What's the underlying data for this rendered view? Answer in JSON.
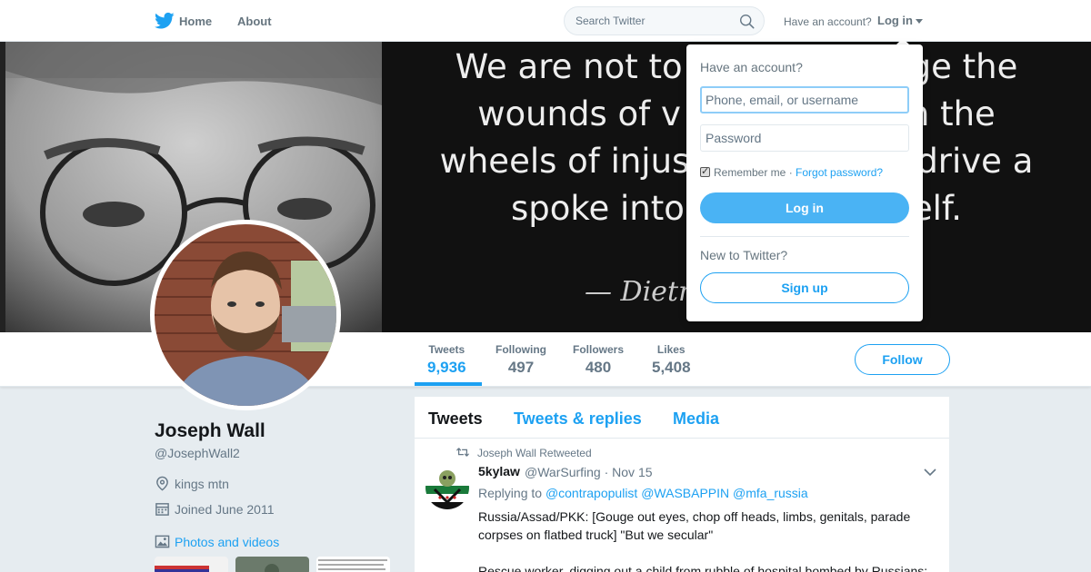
{
  "nav": {
    "home_label": "Home",
    "about_label": "About",
    "search_placeholder": "Search Twitter",
    "have_account": "Have an account?",
    "login_label": "Log in"
  },
  "header": {
    "quote_lines": [
      "We are not to",
      "ge the",
      "wounds of v",
      "n the",
      "wheels of injus",
      "drive a",
      "spoke into",
      "elf."
    ],
    "signature": "— Dietr"
  },
  "stats": {
    "tweets": {
      "label": "Tweets",
      "value": "9,936"
    },
    "following": {
      "label": "Following",
      "value": "497"
    },
    "followers": {
      "label": "Followers",
      "value": "480"
    },
    "likes": {
      "label": "Likes",
      "value": "5,408"
    },
    "follow_label": "Follow"
  },
  "profile": {
    "name": "Joseph Wall",
    "handle": "@JosephWall2",
    "location": "kings mtn",
    "joined": "Joined June 2011",
    "photos_label": "Photos and videos"
  },
  "timeline": {
    "tabs": [
      "Tweets",
      "Tweets & replies",
      "Media"
    ],
    "tweet": {
      "retweet_context": "Joseph Wall Retweeted",
      "name": "5kylaw",
      "handle_date": "@WarSurfing · Nov 15",
      "replying_prefix": "Replying to",
      "mentions": "@contrapopulist @WASBAPPIN @mfa_russia",
      "body": "Russia/Assad/PKK: [Gouge out eyes, chop off heads, limbs, genitals, parade corpses on flatbed truck] \"But we secular\"",
      "body2": "Rescue worker, digging out a child from rubble of hospital bombed by Russians:"
    }
  },
  "dropdown": {
    "title": "Have an account?",
    "username_placeholder": "Phone, email, or username",
    "password_placeholder": "Password",
    "remember": "Remember me",
    "separator": " · ",
    "forgot": "Forgot password?",
    "login_button": "Log in",
    "new_to_twitter": "New to Twitter?",
    "signup_button": "Sign up"
  },
  "colors": {
    "accent": "#1da1f2",
    "login_button": "#4ab3f4",
    "background": "#e6ecf0"
  },
  "icons": [
    "twitter-bird-icon",
    "search-icon",
    "caret-down-icon",
    "location-icon",
    "calendar-icon",
    "photo-icon",
    "retweet-icon",
    "chevron-down-icon"
  ]
}
